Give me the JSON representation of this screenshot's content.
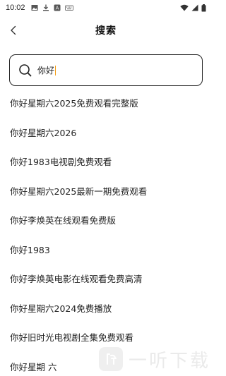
{
  "status_bar": {
    "time": "10:02",
    "left_icons": [
      "image-icon",
      "download-icon",
      "app-icon",
      "keyboard-icon"
    ],
    "right_icons": [
      "wifi-icon",
      "signal-icon",
      "battery-icon"
    ]
  },
  "header": {
    "title": "搜索",
    "back_icon": "chevron-left-icon"
  },
  "search": {
    "value": "你好",
    "icon": "search-icon",
    "caret_color": "#f39c12"
  },
  "suggestions": [
    "你好星期六2025免费观看完整版",
    "你好星期六2026",
    "你好1983电视剧免费观看",
    "你好星期六2025最新一期免费观看",
    "你好李焕英在线观看免费版",
    "你好1983",
    "你好李焕英电影在线观看免费高清",
    "你好星期六2024免费播放",
    "你好旧时光电视剧全集免费观看",
    "你好星期 六"
  ],
  "watermark": {
    "text": "一听下载"
  }
}
